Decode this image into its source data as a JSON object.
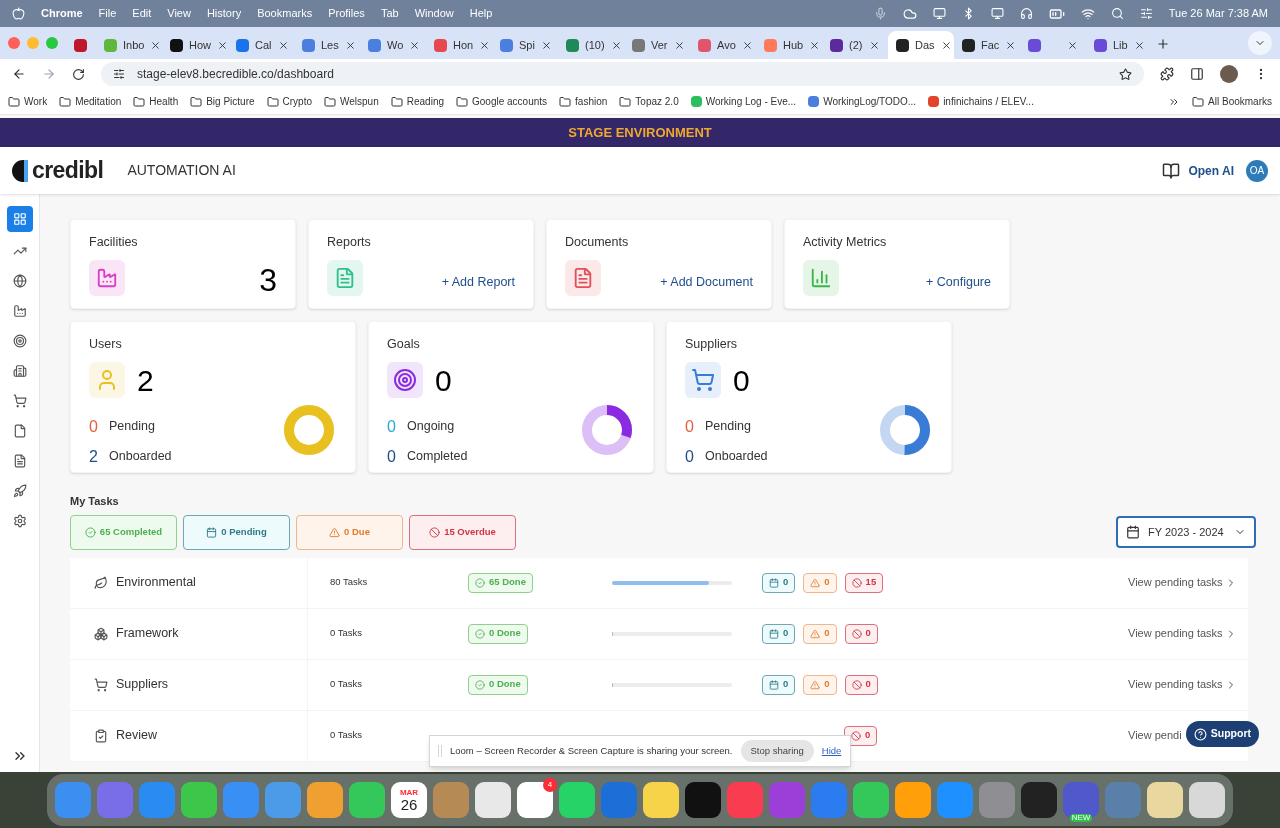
{
  "menu_bar": {
    "app": "Chrome",
    "items": [
      "File",
      "Edit",
      "View",
      "History",
      "Bookmarks",
      "Profiles",
      "Tab",
      "Window",
      "Help"
    ],
    "clock": "Tue 26 Mar  7:38 AM"
  },
  "tabs": [
    {
      "color": "#c0162c",
      "selected": false
    },
    {
      "title": "Inbo",
      "color": "#5fb83c",
      "selected": false
    },
    {
      "title": "How",
      "color": "#111111",
      "selected": false
    },
    {
      "title": "Cal",
      "color": "#1a73e8",
      "selected": false
    },
    {
      "title": "Les",
      "color": "#4a7fe0",
      "selected": false
    },
    {
      "title": "Wo",
      "color": "#4a7fe0",
      "selected": false
    },
    {
      "title": "Hon",
      "color": "#e5484d",
      "selected": false
    },
    {
      "title": "Spi",
      "color": "#4a7fe0",
      "selected": false
    },
    {
      "title": "(10)",
      "color": "#1e8a5a",
      "selected": false
    },
    {
      "title": "Ver",
      "color": "#777777",
      "selected": false
    },
    {
      "title": "Avo",
      "color": "#e0556b",
      "selected": false
    },
    {
      "title": "Hub",
      "color": "#ff7a59",
      "selected": false
    },
    {
      "title": "(2)",
      "color": "#5b2a9e",
      "selected": false
    },
    {
      "title": "Das",
      "color": "#222222",
      "selected": true
    },
    {
      "title": "Fac",
      "color": "#222222",
      "selected": false
    },
    {
      "color": "#6a4bd8",
      "selected": false
    },
    {
      "title": "Lib",
      "color": "#6a4bd8",
      "selected": false
    }
  ],
  "address_bar": {
    "url": "stage-elev8.becredible.co/dashboard"
  },
  "bookmarks": [
    {
      "label": "Work",
      "kind": "folder"
    },
    {
      "label": "Meditation",
      "kind": "folder"
    },
    {
      "label": "Health",
      "kind": "folder"
    },
    {
      "label": "Big Picture",
      "kind": "folder"
    },
    {
      "label": "Crypto",
      "kind": "folder"
    },
    {
      "label": "Welspun",
      "kind": "folder"
    },
    {
      "label": "Reading",
      "kind": "folder"
    },
    {
      "label": "Google accounts",
      "kind": "folder"
    },
    {
      "label": "fashion",
      "kind": "folder"
    },
    {
      "label": "Topaz 2.0",
      "kind": "folder"
    },
    {
      "label": "Working Log - Eve...",
      "kind": "link",
      "color": "#2dbe60"
    },
    {
      "label": "WorkingLog/TODO...",
      "kind": "link",
      "color": "#4a7fe0"
    },
    {
      "label": "infinichains / ELEV...",
      "kind": "link",
      "color": "#e2432a"
    }
  ],
  "all_bookmarks": "All Bookmarks",
  "banner": "STAGE ENVIRONMENT",
  "header": {
    "logo": "credibl",
    "product": "AUTOMATION AI",
    "account": "Open AI",
    "avatar": "OA"
  },
  "sidebar": {
    "items": [
      {
        "selected": true
      },
      {
        "selected": false
      },
      {
        "selected": false
      },
      {
        "selected": false
      },
      {
        "selected": false
      },
      {
        "selected": false
      },
      {
        "selected": false
      },
      {
        "selected": false
      },
      {
        "selected": false
      },
      {
        "selected": false
      },
      {
        "selected": false
      }
    ]
  },
  "summary_cards": [
    {
      "title": "Facilities",
      "kind": "count",
      "value": "3",
      "color": "#d63fc4"
    },
    {
      "title": "Reports",
      "kind": "action",
      "action": "+ Add Report",
      "color": "#2fbf8a"
    },
    {
      "title": "Documents",
      "kind": "action",
      "action": "+ Add Document",
      "color": "#e0505a"
    },
    {
      "title": "Activity Metrics",
      "kind": "action",
      "action": "+ Configure",
      "color": "#3bb54a"
    }
  ],
  "stat_cards": [
    {
      "title": "Users",
      "value": "2",
      "color": "#e8c020",
      "rows": [
        {
          "count": "0",
          "label": "Pending",
          "color": "#e0603a"
        },
        {
          "count": "2",
          "label": "Onboarded",
          "color": "#1f4e8c"
        }
      ],
      "donut": true
    },
    {
      "title": "Goals",
      "value": "0",
      "color": "#8a2be2",
      "rows": [
        {
          "count": "0",
          "label": "Ongoing",
          "color": "#22a9d6"
        },
        {
          "count": "0",
          "label": "Completed",
          "color": "#1f4e8c"
        }
      ],
      "donut": true
    },
    {
      "title": "Suppliers",
      "value": "0",
      "color": "#3a7bd5",
      "rows": [
        {
          "count": "0",
          "label": "Pending",
          "color": "#e0603a"
        },
        {
          "count": "0",
          "label": "Onboarded",
          "color": "#1f4e8c"
        }
      ],
      "donut": true
    }
  ],
  "tasks": {
    "title": "My Tasks",
    "filters": [
      {
        "label": "65 Completed",
        "kind": "done"
      },
      {
        "label": "0 Pending",
        "kind": "pending"
      },
      {
        "label": "0 Due",
        "kind": "due"
      },
      {
        "label": "15 Overdue",
        "kind": "overdue"
      }
    ],
    "period": "FY 2023 - 2024",
    "rows": [
      {
        "name": "Environmental",
        "tasks": "80 Tasks",
        "done": "65 Done",
        "level": 0.81,
        "pending": "0",
        "due": "0",
        "overdue": "15",
        "link": "View pending tasks",
        "covered": false
      },
      {
        "name": "Framework",
        "tasks": "0 Tasks",
        "done": "0 Done",
        "level": 0,
        "pending": "0",
        "due": "0",
        "overdue": "0",
        "link": "View pending tasks",
        "covered": false
      },
      {
        "name": "Suppliers",
        "tasks": "0 Tasks",
        "done": "0 Done",
        "level": 0,
        "pending": "0",
        "due": "0",
        "overdue": "0",
        "link": "View pending tasks",
        "covered": false
      },
      {
        "name": "Review",
        "tasks": "0 Tasks",
        "overdue": "0",
        "link": "View pendi",
        "covered": true
      }
    ]
  },
  "support": "Support",
  "loom": {
    "message": "Loom – Screen Recorder & Screen Capture is sharing your screen.",
    "stop": "Stop sharing",
    "hide": "Hide"
  },
  "dock": {
    "apps": [
      {
        "color": "#3b8ff0"
      },
      {
        "color": "#7a6ee8"
      },
      {
        "color": "#2a8cf0"
      },
      {
        "color": "#3cc74a"
      },
      {
        "color": "#3a8ff5"
      },
      {
        "color": "#4b9be8"
      },
      {
        "color": "#f0a030"
      },
      {
        "color": "#34c759"
      },
      {
        "color": "#ffffff",
        "kind": "calendar",
        "month": "MAR",
        "day": "26"
      },
      {
        "color": "#b58a55"
      },
      {
        "color": "#e8e8e8"
      },
      {
        "color": "#ffffff",
        "badge": "4"
      },
      {
        "color": "#25d366"
      },
      {
        "color": "#1d6fd8"
      },
      {
        "color": "#f7d34a"
      },
      {
        "color": "#111111"
      },
      {
        "color": "#fa3c50"
      },
      {
        "color": "#9b3fd8"
      },
      {
        "color": "#2a7cf0"
      },
      {
        "color": "#34c759"
      },
      {
        "color": "#ff9f0a"
      },
      {
        "color": "#1e90ff"
      },
      {
        "color": "#8e8e93"
      },
      {
        "color": "#222222"
      },
      {
        "color": "#5059c9",
        "badge_text": "NEW"
      },
      {
        "color": "#5a7fa8"
      },
      {
        "color": "#e8d8a0"
      },
      {
        "color": "#d8d8d8"
      }
    ]
  }
}
